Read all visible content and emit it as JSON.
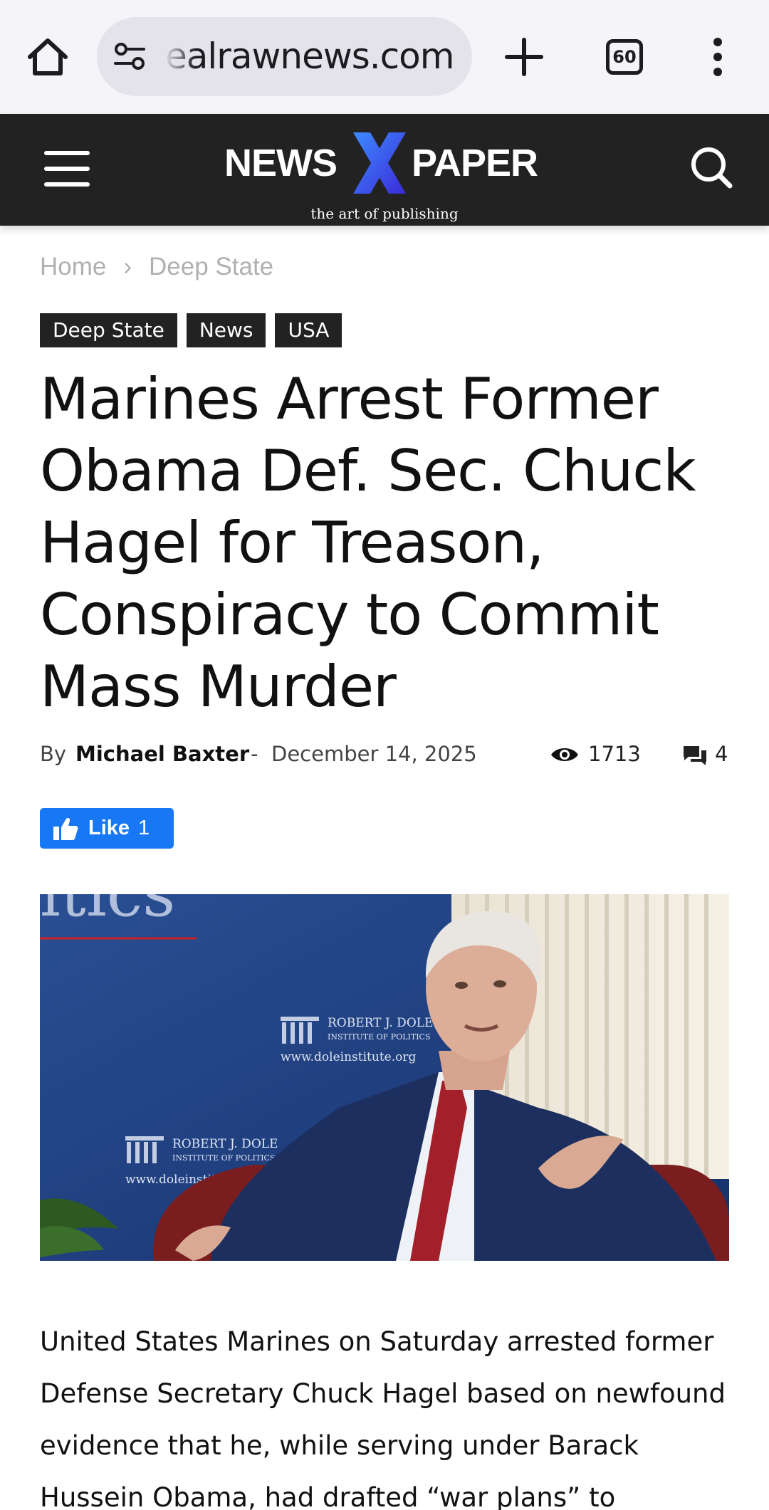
{
  "browser": {
    "url": "ealrawnews.com",
    "tab_count": "60",
    "colors": {
      "toolbar": "#f5f4f9",
      "pill": "#e5e3ea"
    }
  },
  "header": {
    "logo_left": "NEWS",
    "logo_right": "PAPER",
    "logo_tagline": "the art of publishing",
    "colors": {
      "background": "#222222",
      "logo_x": "#2f5cff"
    }
  },
  "breadcrumb": {
    "items": [
      "Home",
      "Deep State"
    ],
    "separator": "›"
  },
  "tags": [
    "Deep State",
    "News",
    "USA"
  ],
  "article": {
    "title": "Marines Arrest Former Obama Def. Sec. Chuck Hagel for Treason, Conspiracy to Commit Mass Murder",
    "by_label": "By",
    "author": "Michael Baxter",
    "dash": "-",
    "date": "December 14, 2025",
    "views": "1713",
    "comments": "4",
    "like_label": "Like",
    "like_count": "1",
    "hero_image_text": {
      "institute_name": "ROBERT J. DOLE",
      "institute_sub": "INSTITUTE OF POLITICS",
      "website": "www.doleinstitute.org"
    },
    "body": "United States Marines on Saturday arrested former Defense Secretary Chuck Hagel based on newfound evidence that he, while serving under Barack Hussein Obama, had drafted “war plans” to"
  },
  "icons": [
    "home-icon",
    "tune-icon",
    "plus-icon",
    "tabs-icon",
    "more-vert-icon",
    "hamburger-icon",
    "search-icon",
    "eye-icon",
    "comments-icon",
    "thumbs-up-icon"
  ],
  "colors": {
    "like_button": "#1877f2",
    "tag_bg": "#222222"
  }
}
